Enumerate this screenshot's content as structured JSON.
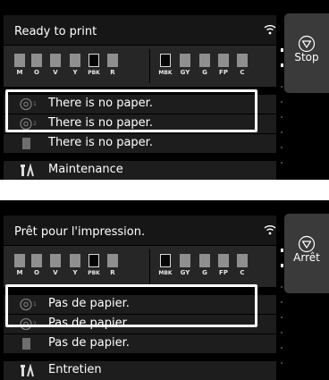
{
  "panels": [
    {
      "status": "Ready to print",
      "rows": [
        "There is no paper.",
        "There is no paper.",
        "There is no paper.",
        "Maintenance"
      ],
      "stop_label": "Stop"
    },
    {
      "status": "Prêt pour l'impression.",
      "rows": [
        "Pas de papier.",
        "Pas de papier.",
        "Pas de papier.",
        "Entretien"
      ],
      "stop_label": "Arrêt"
    }
  ],
  "inks": {
    "left": [
      "M",
      "O",
      "V",
      "Y",
      "PBK",
      "R"
    ],
    "right": [
      "MBK",
      "GY",
      "G",
      "FP",
      "C"
    ]
  },
  "roll_numbers": [
    "1",
    "2"
  ],
  "icons": {
    "wifi": "wifi-icon",
    "roll1": "paper-roll-1-icon",
    "roll2": "paper-roll-2-icon",
    "cut_sheet": "cut-sheet-icon",
    "maintenance": "maintenance-icon",
    "stop": "stop-icon"
  },
  "colors": {
    "background": "#000000",
    "row": "#1d1d1d",
    "ink_chip": "#8f8f8f",
    "highlight": "#ffffff",
    "stop_button": "#3a3a3a"
  }
}
